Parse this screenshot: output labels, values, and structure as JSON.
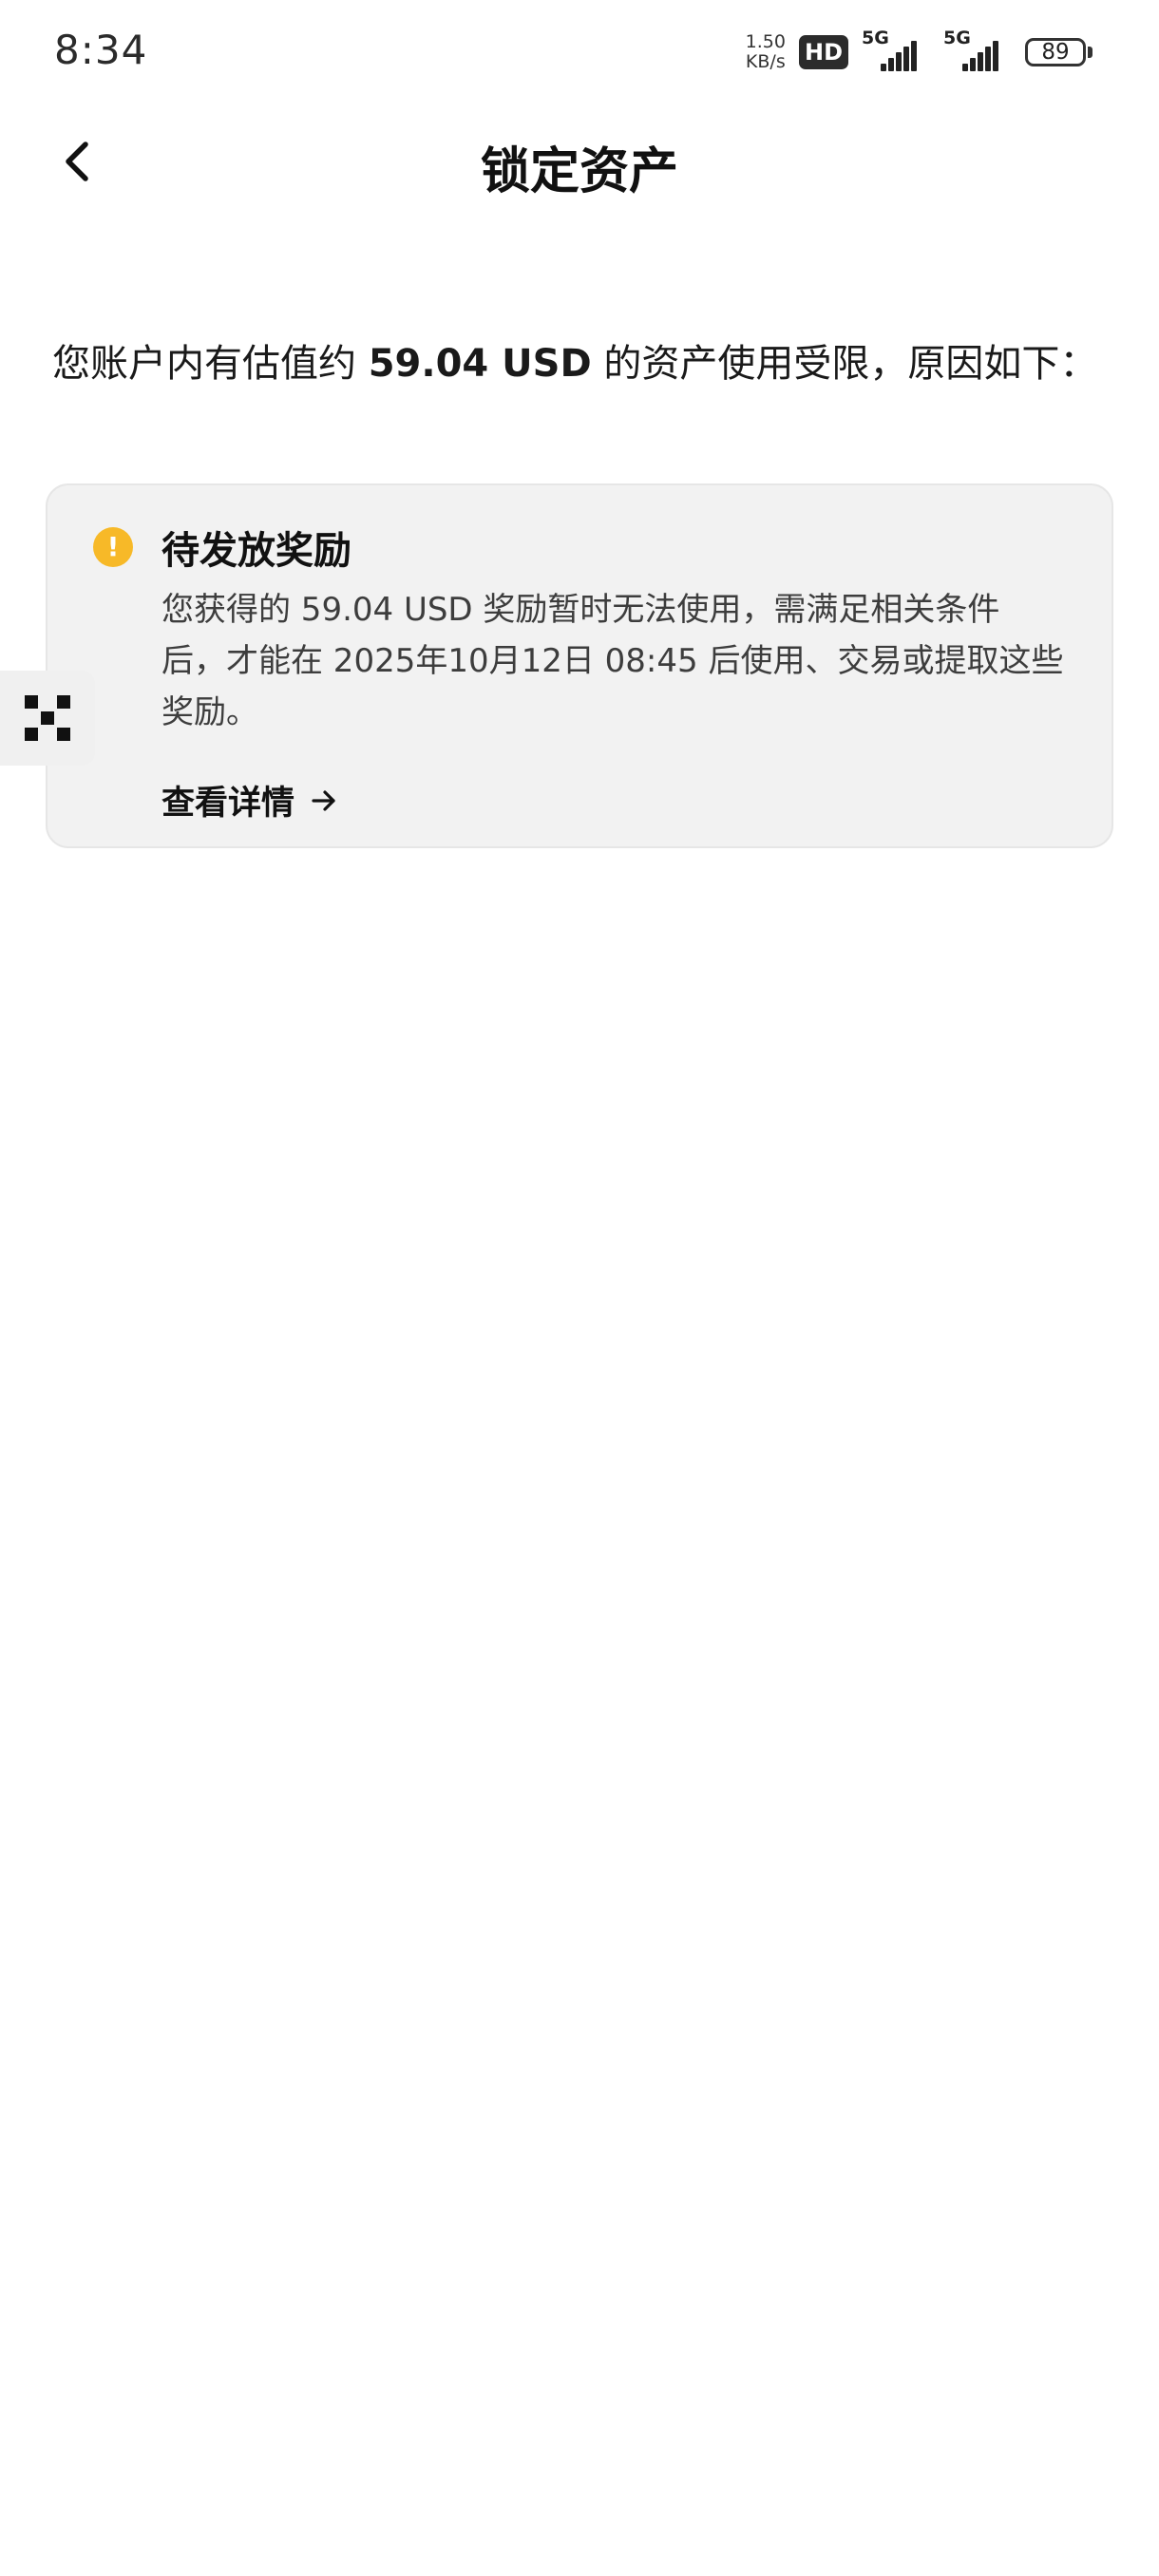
{
  "status_bar": {
    "time": "8:34",
    "net_speed_value": "1.50",
    "net_speed_unit": "KB/s",
    "hd_label": "HD",
    "sim1_label": "5G",
    "sim2_label": "5G",
    "battery": "89"
  },
  "header": {
    "title": "锁定资产",
    "back_icon": "chevron-left-icon"
  },
  "intro": {
    "prefix": "您账户内有估值约 ",
    "amount": "59.04 USD",
    "suffix": " 的资产使用受限，原因如下："
  },
  "card": {
    "icon": "warning-icon",
    "accent_color": "#f7b928",
    "title": "待发放奖励",
    "description": "您获得的 59.04 USD 奖励暂时无法使用，需满足相关条件后，才能在 2025年10月12日 08:45 后使用、交易或提取这些奖励。",
    "link_label": "查看详情"
  },
  "side_tab": {
    "icon": "qr-logo-icon"
  }
}
